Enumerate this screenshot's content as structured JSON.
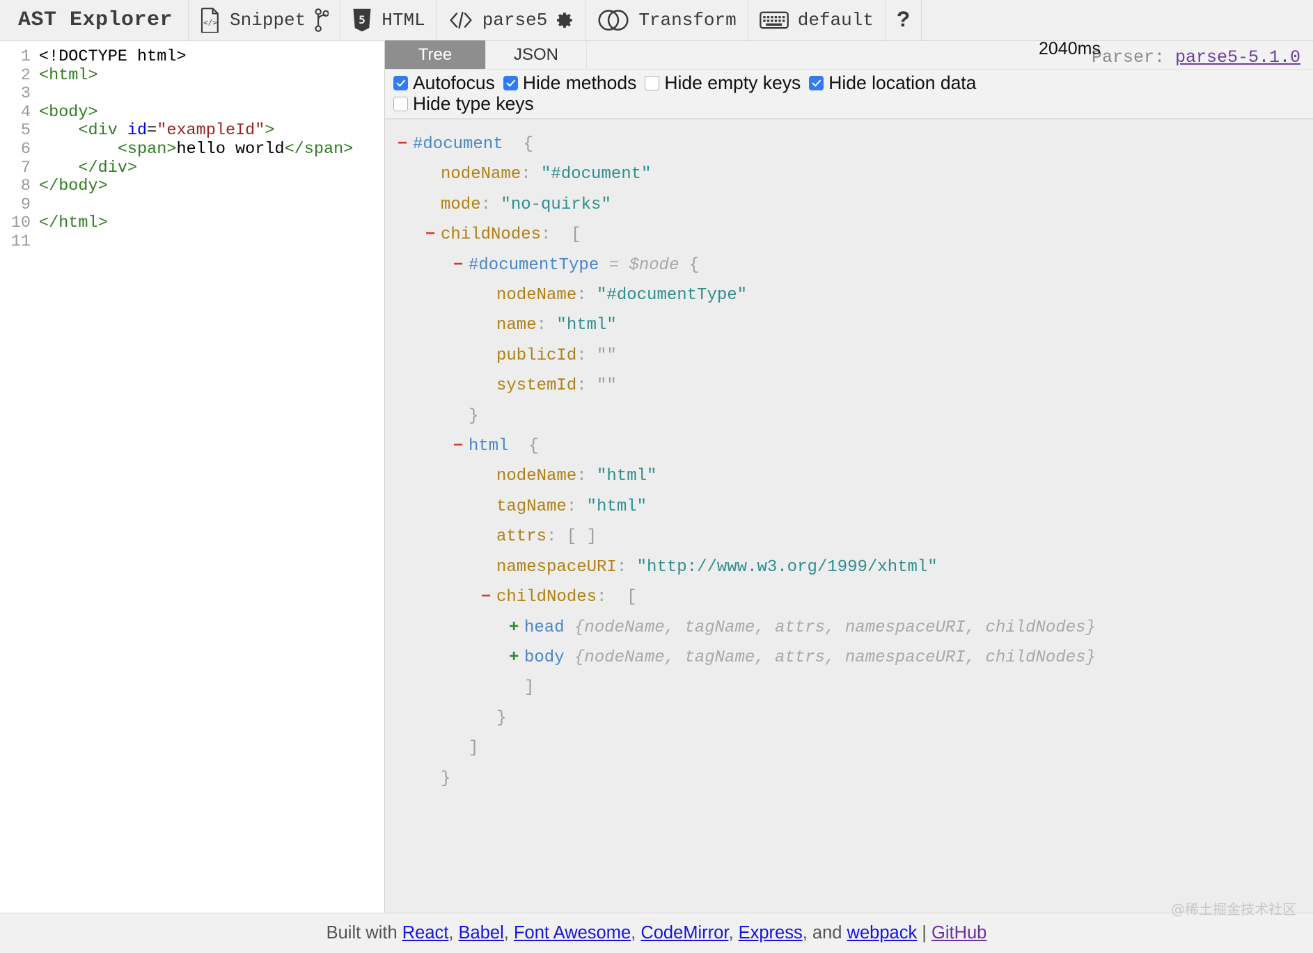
{
  "toolbar": {
    "brand": "AST Explorer",
    "snippet_label": "Snippet",
    "snippet_icon": "code-file-icon",
    "fork_icon": "code-branch-icon",
    "language_label": "HTML",
    "language_icon": "html5-shield-icon",
    "parser_label": "parse5",
    "parser_icon": "code-brackets-icon",
    "settings_icon": "gear-icon",
    "transform_label": "Transform",
    "transform_icon": "two-circles-icon",
    "keymap_label": "default",
    "keymap_icon": "keyboard-icon",
    "help_label": "?"
  },
  "editor": {
    "line_numbers": [
      "1",
      "2",
      "3",
      "4",
      "5",
      "6",
      "7",
      "8",
      "9",
      "10",
      "11"
    ],
    "lines": [
      [
        {
          "t": "<!DOCTYPE html>",
          "c": "meta"
        }
      ],
      [
        {
          "t": "<html>",
          "c": "tag"
        }
      ],
      [],
      [
        {
          "t": "<body>",
          "c": "tag"
        }
      ],
      [
        {
          "t": "    <div ",
          "c": "tag"
        },
        {
          "t": "id",
          "c": "attr"
        },
        {
          "t": "=",
          "c": "txt"
        },
        {
          "t": "\"exampleId\"",
          "c": "str"
        },
        {
          "t": ">",
          "c": "tag"
        }
      ],
      [
        {
          "t": "        <span>",
          "c": "tag"
        },
        {
          "t": "hello world",
          "c": "txt"
        },
        {
          "t": "</span>",
          "c": "tag"
        }
      ],
      [
        {
          "t": "    </div>",
          "c": "tag"
        }
      ],
      [
        {
          "t": "</body>",
          "c": "tag"
        }
      ],
      [],
      [
        {
          "t": "</html>",
          "c": "tag"
        }
      ],
      []
    ]
  },
  "ast": {
    "tabs": [
      {
        "label": "Tree",
        "active": true
      },
      {
        "label": "JSON",
        "active": false
      }
    ],
    "parser_prefix": "Parser: ",
    "parser_name": "parse5-5.1.0",
    "timing": "2040ms",
    "options": [
      {
        "label": "Autofocus",
        "checked": true
      },
      {
        "label": "Hide methods",
        "checked": true
      },
      {
        "label": "Hide empty keys",
        "checked": false
      },
      {
        "label": "Hide location data",
        "checked": true
      },
      {
        "label": "Hide type keys",
        "checked": false
      }
    ],
    "tree_rows": [
      {
        "indent": 0,
        "toggle": "minus",
        "parts": [
          {
            "t": "#document",
            "c": "node"
          },
          {
            "t": "  ",
            "c": "pun"
          },
          {
            "t": "{",
            "c": "pun"
          }
        ]
      },
      {
        "indent": 1,
        "toggle": "none",
        "parts": [
          {
            "t": "nodeName",
            "c": "key"
          },
          {
            "t": ": ",
            "c": "pun"
          },
          {
            "t": "\"#document\"",
            "c": "str"
          }
        ]
      },
      {
        "indent": 1,
        "toggle": "none",
        "parts": [
          {
            "t": "mode",
            "c": "key"
          },
          {
            "t": ": ",
            "c": "pun"
          },
          {
            "t": "\"no-quirks\"",
            "c": "str"
          }
        ]
      },
      {
        "indent": 1,
        "toggle": "minus",
        "parts": [
          {
            "t": "childNodes",
            "c": "key"
          },
          {
            "t": ":  ",
            "c": "pun"
          },
          {
            "t": "[",
            "c": "pun"
          }
        ]
      },
      {
        "indent": 2,
        "toggle": "minus",
        "parts": [
          {
            "t": "#documentType",
            "c": "node"
          },
          {
            "t": " = ",
            "c": "dim"
          },
          {
            "t": "$node",
            "c": "dim"
          },
          {
            "t": " {",
            "c": "pun"
          }
        ]
      },
      {
        "indent": 3,
        "toggle": "none",
        "parts": [
          {
            "t": "nodeName",
            "c": "key"
          },
          {
            "t": ": ",
            "c": "pun"
          },
          {
            "t": "\"#documentType\"",
            "c": "str"
          }
        ]
      },
      {
        "indent": 3,
        "toggle": "none",
        "parts": [
          {
            "t": "name",
            "c": "key"
          },
          {
            "t": ": ",
            "c": "pun"
          },
          {
            "t": "\"html\"",
            "c": "str"
          }
        ]
      },
      {
        "indent": 3,
        "toggle": "none",
        "parts": [
          {
            "t": "publicId",
            "c": "key"
          },
          {
            "t": ": ",
            "c": "pun"
          },
          {
            "t": "\"\"",
            "c": "pun"
          }
        ]
      },
      {
        "indent": 3,
        "toggle": "none",
        "parts": [
          {
            "t": "systemId",
            "c": "key"
          },
          {
            "t": ": ",
            "c": "pun"
          },
          {
            "t": "\"\"",
            "c": "pun"
          }
        ]
      },
      {
        "indent": 2,
        "toggle": "none",
        "parts": [
          {
            "t": "}",
            "c": "pun"
          }
        ]
      },
      {
        "indent": 2,
        "toggle": "minus",
        "parts": [
          {
            "t": "html",
            "c": "node"
          },
          {
            "t": "  ",
            "c": "pun"
          },
          {
            "t": "{",
            "c": "pun"
          }
        ]
      },
      {
        "indent": 3,
        "toggle": "none",
        "parts": [
          {
            "t": "nodeName",
            "c": "key"
          },
          {
            "t": ": ",
            "c": "pun"
          },
          {
            "t": "\"html\"",
            "c": "str"
          }
        ]
      },
      {
        "indent": 3,
        "toggle": "none",
        "parts": [
          {
            "t": "tagName",
            "c": "key"
          },
          {
            "t": ": ",
            "c": "pun"
          },
          {
            "t": "\"html\"",
            "c": "str"
          }
        ]
      },
      {
        "indent": 3,
        "toggle": "none",
        "parts": [
          {
            "t": "attrs",
            "c": "key"
          },
          {
            "t": ": ",
            "c": "pun"
          },
          {
            "t": "[ ]",
            "c": "pun"
          }
        ]
      },
      {
        "indent": 3,
        "toggle": "none",
        "parts": [
          {
            "t": "namespaceURI",
            "c": "key"
          },
          {
            "t": ": ",
            "c": "pun"
          },
          {
            "t": "\"http://www.w3.org/1999/xhtml\"",
            "c": "str"
          }
        ]
      },
      {
        "indent": 3,
        "toggle": "minus",
        "parts": [
          {
            "t": "childNodes",
            "c": "key"
          },
          {
            "t": ":  ",
            "c": "pun"
          },
          {
            "t": "[",
            "c": "pun"
          }
        ]
      },
      {
        "indent": 4,
        "toggle": "plus",
        "parts": [
          {
            "t": "head",
            "c": "node"
          },
          {
            "t": " {nodeName, tagName, attrs, namespaceURI, childNodes}",
            "c": "dim"
          }
        ]
      },
      {
        "indent": 4,
        "toggle": "plus",
        "parts": [
          {
            "t": "body",
            "c": "node"
          },
          {
            "t": " {nodeName, tagName, attrs, namespaceURI, childNodes}",
            "c": "dim"
          }
        ]
      },
      {
        "indent": 4,
        "toggle": "none",
        "parts": [
          {
            "t": "]",
            "c": "pun"
          }
        ]
      },
      {
        "indent": 3,
        "toggle": "none",
        "parts": [
          {
            "t": "}",
            "c": "pun"
          }
        ]
      },
      {
        "indent": 2,
        "toggle": "none",
        "parts": [
          {
            "t": "]",
            "c": "pun"
          }
        ]
      },
      {
        "indent": 1,
        "toggle": "none",
        "parts": [
          {
            "t": "}",
            "c": "pun"
          }
        ]
      }
    ]
  },
  "footer": {
    "prefix": "Built with ",
    "links": [
      {
        "label": "React",
        "visited": false,
        "after": ", "
      },
      {
        "label": "Babel",
        "visited": false,
        "after": ", "
      },
      {
        "label": "Font Awesome",
        "visited": false,
        "after": ", "
      },
      {
        "label": "CodeMirror",
        "visited": false,
        "after": ", "
      },
      {
        "label": "Express",
        "visited": false,
        "after": ", and "
      },
      {
        "label": "webpack",
        "visited": false,
        "after": " | "
      },
      {
        "label": "GitHub",
        "visited": true,
        "after": ""
      }
    ],
    "watermark": "@稀土掘金技术社区"
  },
  "colors": {
    "tab_active_bg": "#8e8e8e",
    "checkbox_on": "#2f7cf6",
    "link": "#1414dd",
    "link_visited": "#6b2f9e",
    "tree_node": "#4a86c8",
    "tree_key": "#b08114",
    "tree_string": "#2f8e8e",
    "toggle_minus": "#d13b2e",
    "toggle_plus": "#2f8a2f"
  }
}
